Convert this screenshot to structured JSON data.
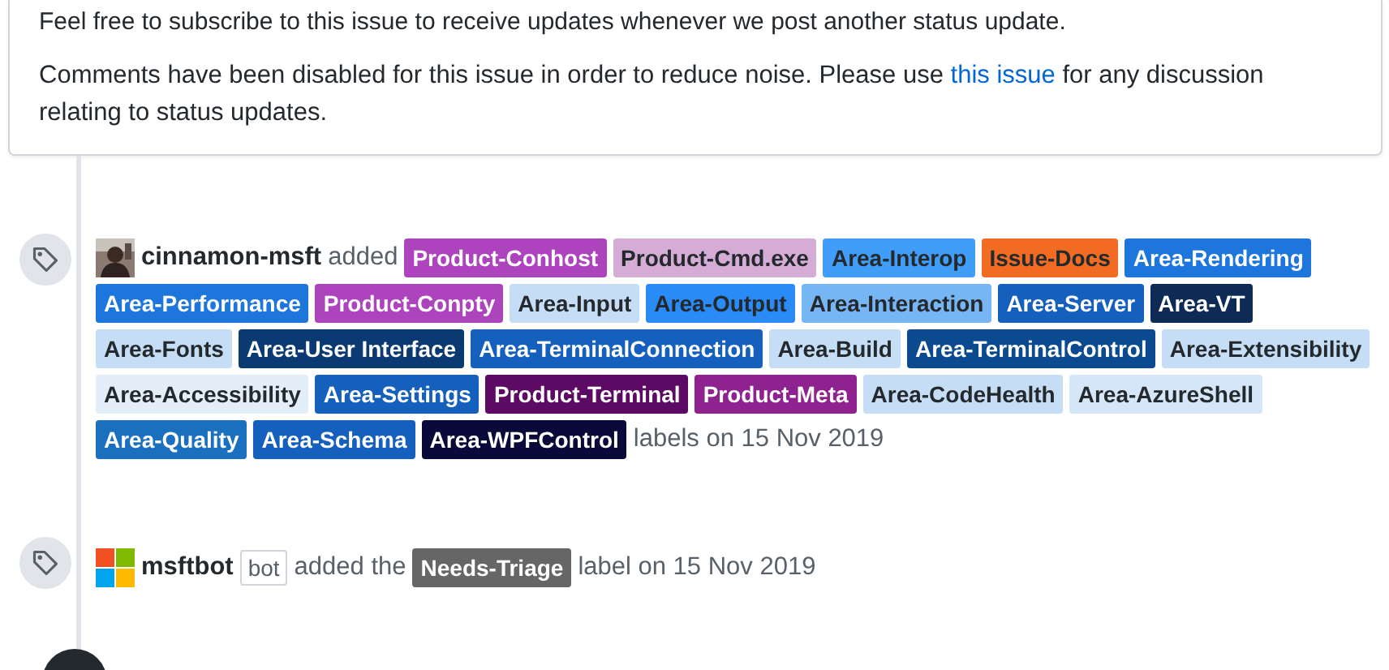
{
  "notice": {
    "cut_line": "Feel free to subscribe to this issue to receive updates whenever we post another status update.",
    "text_before": "Comments have been disabled for this issue in order to reduce noise. Please use",
    "link": "this issue",
    "text_after": "for any discussion relating to status updates."
  },
  "events": [
    {
      "kind": "labels",
      "actor": "cinnamon-msft",
      "action": "added",
      "suffix": "labels on 15 Nov 2019",
      "labels": [
        {
          "name": "Product-Conhost",
          "color": "#ad44be"
        },
        {
          "name": "Product-Cmd.exe",
          "color": "#d4acd6"
        },
        {
          "name": "Area-Interop",
          "color": "#409ef8"
        },
        {
          "name": "Issue-Docs",
          "color": "#f26b22"
        },
        {
          "name": "Area-Rendering",
          "color": "#1d76db"
        },
        {
          "name": "Area-Performance",
          "color": "#1d76db"
        },
        {
          "name": "Product-Conpty",
          "color": "#ad44be"
        },
        {
          "name": "Area-Input",
          "color": "#c5def5"
        },
        {
          "name": "Area-Output",
          "color": "#2a8af6"
        },
        {
          "name": "Area-Interaction",
          "color": "#77b6f5"
        },
        {
          "name": "Area-Server",
          "color": "#1560bd"
        },
        {
          "name": "Area-VT",
          "color": "#0d2b54"
        },
        {
          "name": "Area-Fonts",
          "color": "#c5def5"
        },
        {
          "name": "Area-User Interface",
          "color": "#0b3a73"
        },
        {
          "name": "Area-TerminalConnection",
          "color": "#1560bd"
        },
        {
          "name": "Area-Build",
          "color": "#c5def5"
        },
        {
          "name": "Area-TerminalControl",
          "color": "#0b4a8f"
        },
        {
          "name": "Area-Extensibility",
          "color": "#c5def5"
        },
        {
          "name": "Area-Accessibility",
          "color": "#e4eef9"
        },
        {
          "name": "Area-Settings",
          "color": "#1560bd"
        },
        {
          "name": "Product-Terminal",
          "color": "#5c0a63"
        },
        {
          "name": "Product-Meta",
          "color": "#8e228f"
        },
        {
          "name": "Area-CodeHealth",
          "color": "#c5def5"
        },
        {
          "name": "Area-AzureShell",
          "color": "#d4e6f7"
        },
        {
          "name": "Area-Quality",
          "color": "#1a6fbf"
        },
        {
          "name": "Area-Schema",
          "color": "#1560bd"
        },
        {
          "name": "Area-WPFControl",
          "color": "#0a0a3a"
        }
      ]
    },
    {
      "kind": "label",
      "actor": "msftbot",
      "badge": "bot",
      "action": "added the",
      "suffix": "label on 15 Nov 2019",
      "labels": [
        {
          "name": "Needs-Triage",
          "color": "#666666"
        }
      ]
    }
  ]
}
